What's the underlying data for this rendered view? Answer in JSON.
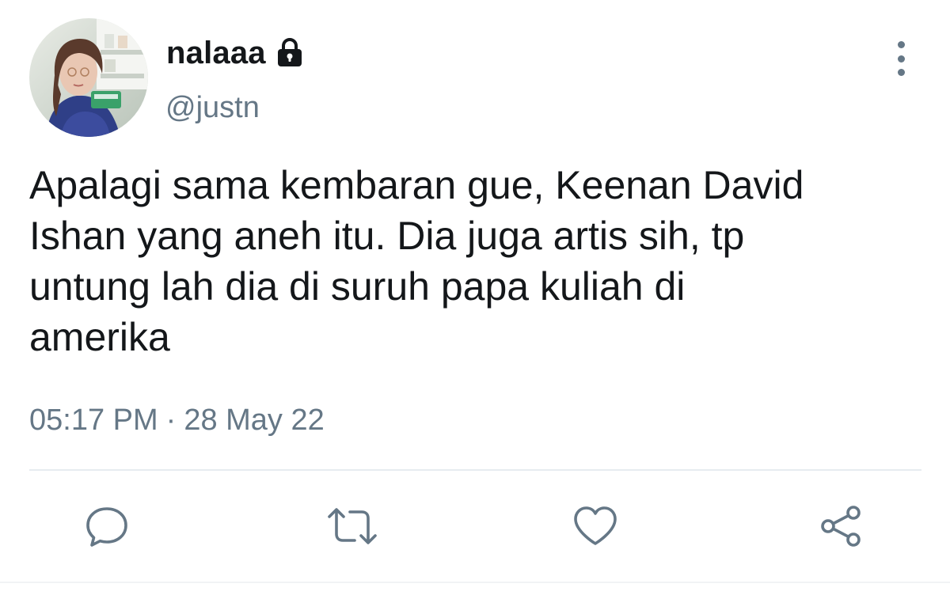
{
  "user": {
    "display_name": "nalaaa",
    "handle": "@justn",
    "protected_icon": "lock-icon",
    "avatar": "profile-photo"
  },
  "tweet": {
    "text": "Apalagi sama kembaran gue, Keenan David\nIshan yang aneh itu. Dia juga artis sih, tp\nuntung lah dia di suruh papa kuliah di\namerika",
    "time": "05:17 PM",
    "separator": "·",
    "date": "28 May 22"
  },
  "actions": [
    {
      "icon": "reply-icon"
    },
    {
      "icon": "retweet-icon"
    },
    {
      "icon": "like-icon"
    },
    {
      "icon": "share-icon"
    }
  ],
  "menu_icon": "more-vertical-icon",
  "colors": {
    "text_primary": "#14171a",
    "text_secondary": "#657786",
    "divider": "#e6ecf0"
  }
}
